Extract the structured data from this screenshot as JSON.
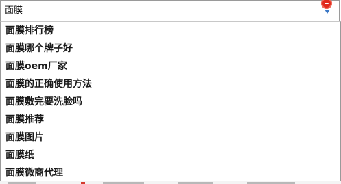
{
  "search": {
    "value": "面膜"
  },
  "icons": {
    "clear": "clear-search-icon",
    "dropdown": "dropdown-arrow-icon"
  },
  "colors": {
    "clear_button": "#e02b1e",
    "dropdown_arrow": "#3b78c6",
    "border": "#9a9a9a"
  },
  "suggestions": [
    "面膜排行榜",
    "面膜哪个牌子好",
    "面膜oem厂家",
    "面膜的正确使用方法",
    "面膜敷完要洗脸吗",
    "面膜推荐",
    "面膜图片",
    "面膜纸",
    "面膜微商代理"
  ]
}
